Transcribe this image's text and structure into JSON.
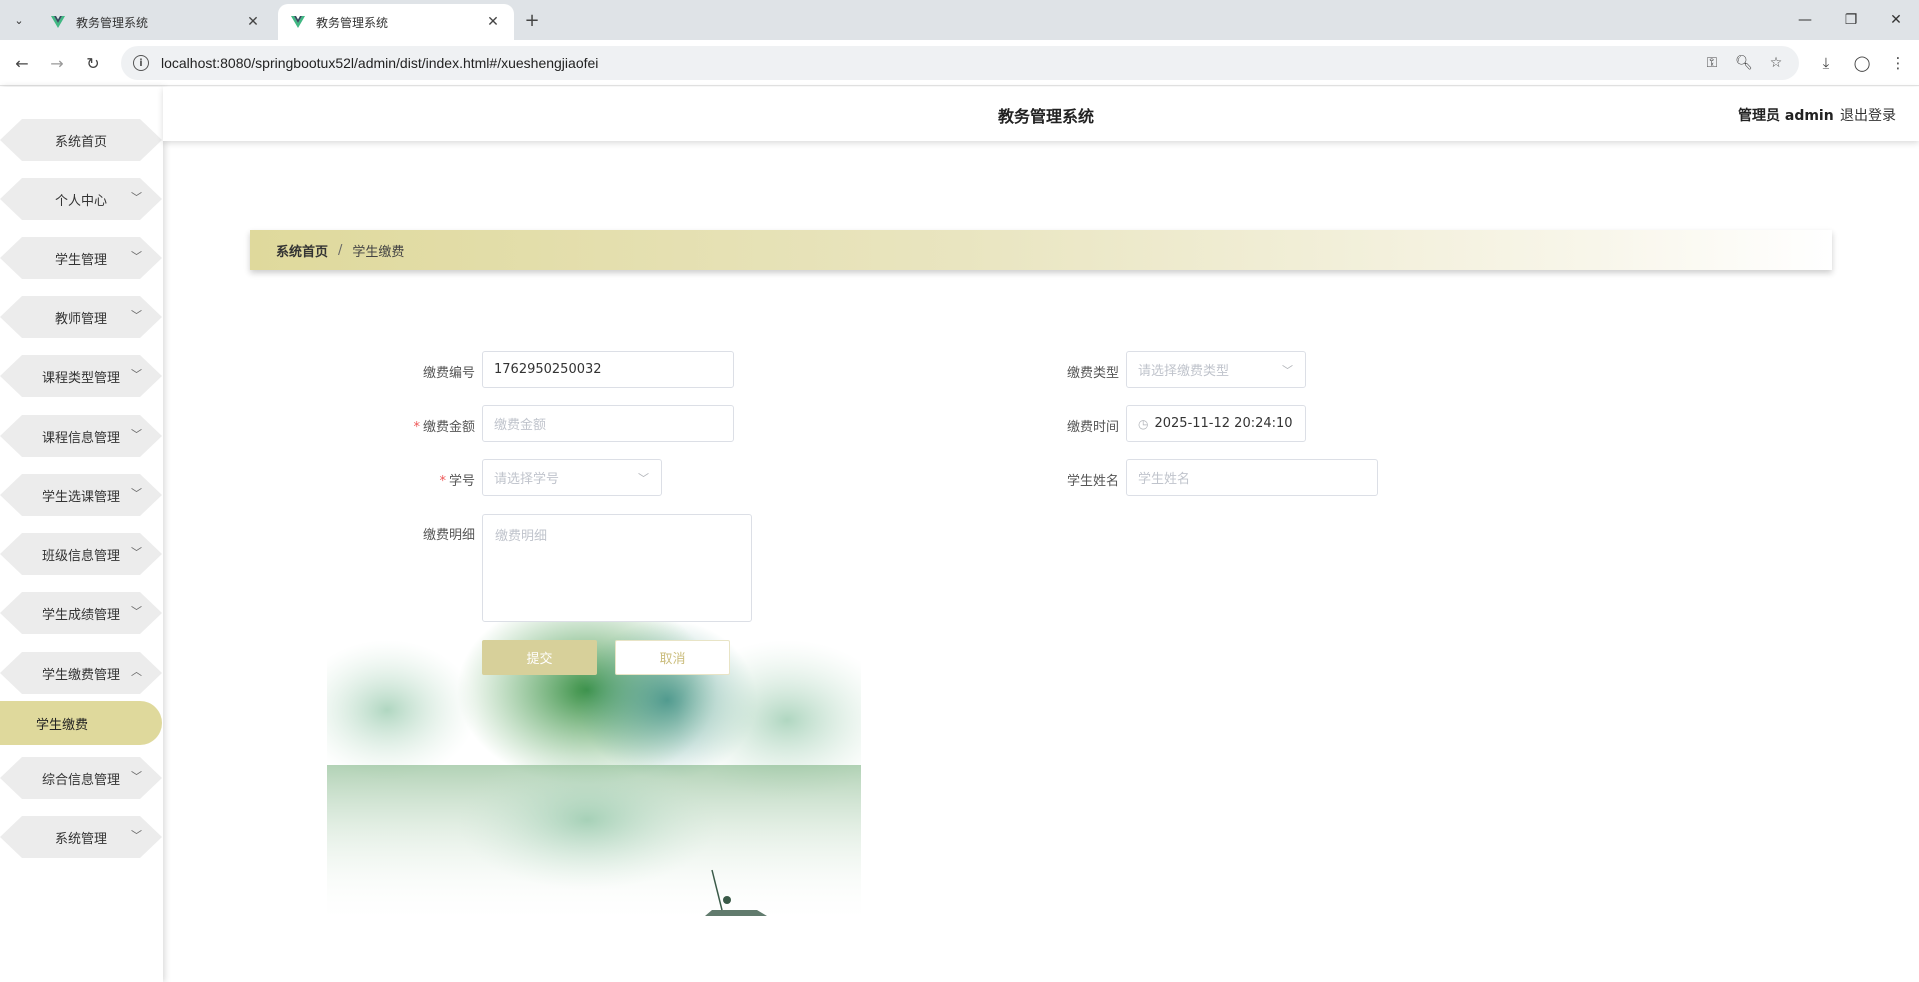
{
  "browser": {
    "tabs": [
      {
        "title": "教务管理系统",
        "active": false
      },
      {
        "title": "教务管理系统",
        "active": true
      }
    ],
    "url": "localhost:8080/springbootux52l/admin/dist/index.html#/xueshengjiaofei",
    "icons": [
      "tab-list-icon",
      "new-tab-icon",
      "minimize-icon",
      "restore-icon",
      "close-window-icon",
      "back-icon",
      "forward-icon",
      "reload-icon",
      "site-info-icon",
      "password-key-icon",
      "zoom-icon",
      "bookmark-star-icon",
      "download-icon",
      "profile-icon",
      "menu-icon"
    ]
  },
  "header": {
    "title": "教务管理系统",
    "user": "管理员 admin",
    "logout": "退出登录"
  },
  "sidebar": {
    "items": [
      {
        "label": "系统首页",
        "expandable": false
      },
      {
        "label": "个人中心",
        "expandable": true
      },
      {
        "label": "学生管理",
        "expandable": true
      },
      {
        "label": "教师管理",
        "expandable": true
      },
      {
        "label": "课程类型管理",
        "expandable": true
      },
      {
        "label": "课程信息管理",
        "expandable": true
      },
      {
        "label": "学生选课管理",
        "expandable": true
      },
      {
        "label": "班级信息管理",
        "expandable": true
      },
      {
        "label": "学生成绩管理",
        "expandable": true
      },
      {
        "label": "学生缴费管理",
        "expandable": true,
        "expanded": true
      },
      {
        "label": "综合信息管理",
        "expandable": true
      },
      {
        "label": "系统管理",
        "expandable": true
      }
    ],
    "active_sub": "学生缴费"
  },
  "breadcrumb": {
    "home": "系统首页",
    "separator": "/",
    "current": "学生缴费"
  },
  "form": {
    "payment_no": {
      "label": "缴费编号",
      "value": "1762950250032"
    },
    "amount": {
      "label": "缴费金额",
      "placeholder": "缴费金额",
      "required": true
    },
    "student_no": {
      "label": "学号",
      "placeholder": "请选择学号",
      "required": true
    },
    "detail": {
      "label": "缴费明细",
      "placeholder": "缴费明细"
    },
    "payment_type": {
      "label": "缴费类型",
      "placeholder": "请选择缴费类型"
    },
    "payment_time": {
      "label": "缴费时间",
      "value": "2025-11-12 20:24:10"
    },
    "student_name": {
      "label": "学生姓名",
      "placeholder": "学生姓名"
    },
    "submit": "提交",
    "cancel": "取消"
  },
  "colors": {
    "accent": "#dfd99c",
    "submit_bg": "#d7d09a"
  }
}
